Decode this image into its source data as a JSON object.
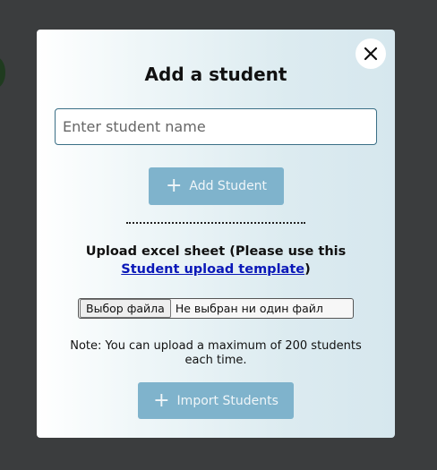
{
  "modal": {
    "title": "Add a student",
    "name_input": {
      "placeholder": "Enter student name",
      "value": ""
    },
    "add_button_label": "Add Student",
    "upload_text_prefix": "Upload excel sheet (Please use this ",
    "upload_link_text": "Student upload template",
    "upload_text_suffix": ")",
    "file_input": {
      "button_label": "Выбор файла",
      "status_text": "Не выбран ни один файл"
    },
    "note": "Note: You can upload a maximum of 200 students each time.",
    "import_button_label": "Import Students"
  },
  "icons": {
    "close": "close-icon",
    "plus": "plus-icon"
  },
  "colors": {
    "overlay": "#3b3d3e",
    "button": "#7fb3cc",
    "link": "#0a18b8"
  }
}
